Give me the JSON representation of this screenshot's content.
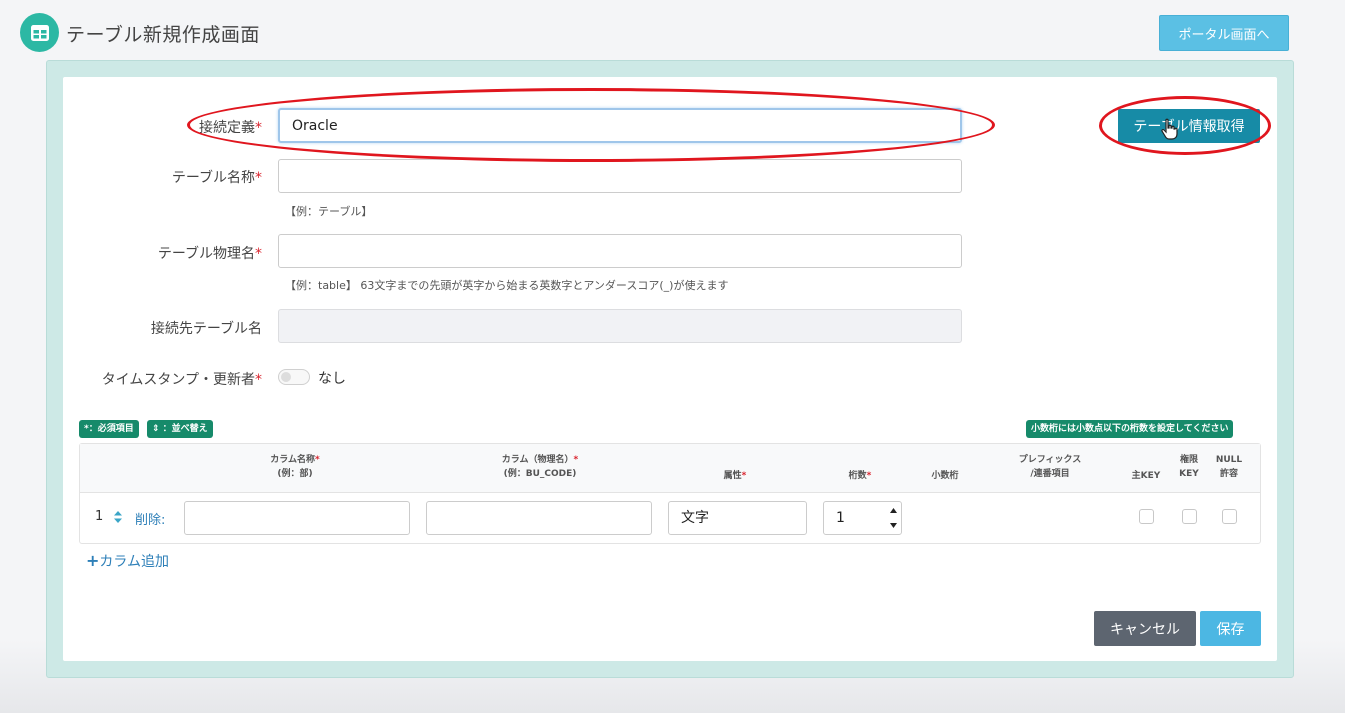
{
  "header": {
    "title": "テーブル新規作成画面",
    "portal_button": "ポータル画面へ"
  },
  "form": {
    "connection": {
      "label": "接続定義",
      "required_mark": "*",
      "value": "Oracle"
    },
    "table_name": {
      "label": "テーブル名称",
      "required_mark": "*",
      "value": "",
      "hint": "【例：テーブル】"
    },
    "physical_name": {
      "label": "テーブル物理名",
      "required_mark": "*",
      "value": "",
      "hint": "【例：table】 63文字までの先頭が英字から始まる英数字とアンダースコア(_)が使えます"
    },
    "dest_table": {
      "label": "接続先テーブル名",
      "value": ""
    },
    "timestamp": {
      "label": "タイムスタンプ・更新者",
      "required_mark": "*",
      "toggle_label": "なし",
      "enabled": false
    },
    "get_info_button": "テーブル情報取得"
  },
  "badges": {
    "required": "*：必須項目",
    "sort": "⇕ ：並べ替え",
    "decimal_note": "小数桁には小数点以下の桁数を設定してください"
  },
  "columns_table": {
    "headers": {
      "col_name": "カラム名称",
      "col_name_ex": "(例：部)",
      "col_phys": "カラム（物理名）",
      "col_phys_ex": "(例：BU_CODE)",
      "attr": "属性",
      "digits": "桁数",
      "decimal": "小数桁",
      "prefix_1": "プレフィックス",
      "prefix_2": "/連番項目",
      "primary_key": "主KEY",
      "perm_1": "権限",
      "perm_2": "KEY",
      "null_1": "NULL",
      "null_2": "許容",
      "req": "*"
    },
    "rows": [
      {
        "num": "1",
        "delete": "削除:",
        "col_name": "",
        "col_phys": "",
        "attr": "文字",
        "digits": "1"
      }
    ]
  },
  "add_column": {
    "plus": "+",
    "label": "カラム追加"
  },
  "footer": {
    "cancel": "キャンセル",
    "save": "保存"
  },
  "colors": {
    "accent": "#178ba6",
    "required": "#d9232d",
    "badge": "#168a6a",
    "highlight": "#e0161e"
  }
}
